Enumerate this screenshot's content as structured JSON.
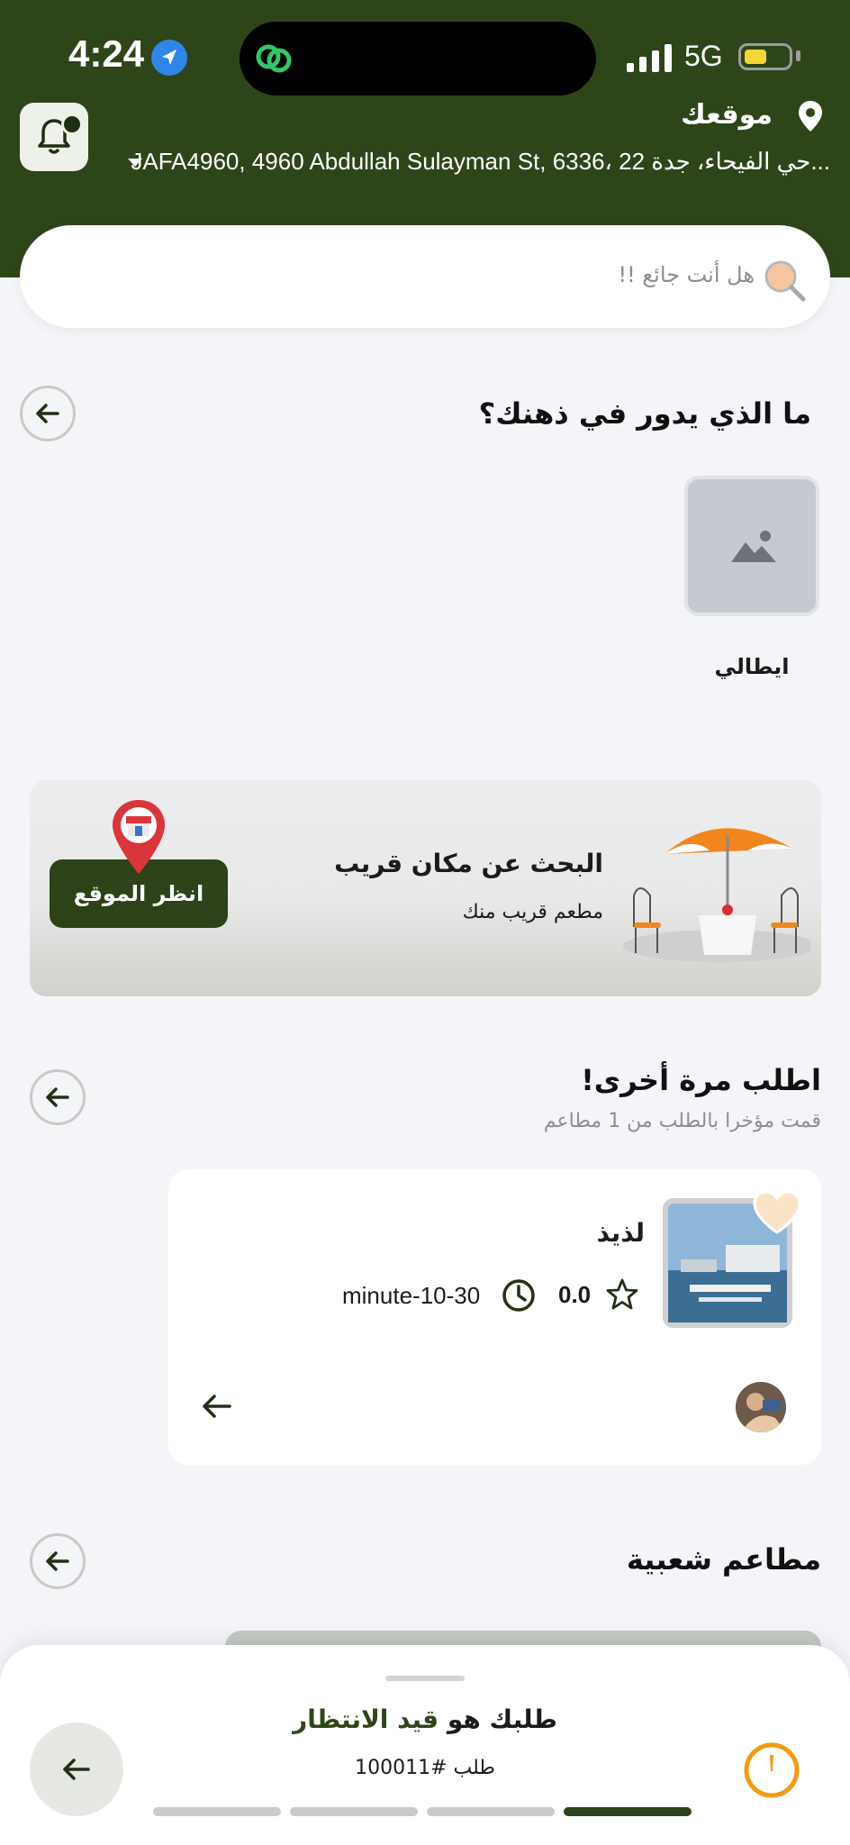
{
  "status_bar": {
    "time": "4:24",
    "network": "5G"
  },
  "header": {
    "location_title": "موقعك",
    "address": "JAFA4960, 4960 Abdullah Sulayman St, 6336، حي الفيحاء، جدة 22..."
  },
  "search": {
    "placeholder": "هل أنت جائع !!"
  },
  "categories_section": {
    "title": "ما الذي يدور في ذهنك؟",
    "items": [
      {
        "label": "ايطالي"
      }
    ]
  },
  "nearby_banner": {
    "title": "البحث عن مكان قريب",
    "subtitle": "مطعم قريب منك",
    "button_label": "انظر الموقع"
  },
  "reorder_section": {
    "title": "اطلب مرة أخرى!",
    "subtitle": "قمت مؤخرا بالطلب من 1 مطاعم",
    "restaurant": {
      "name": "لذيذ",
      "rating": "0.0",
      "delivery_time": "minute-10-30"
    }
  },
  "popular_section": {
    "title": "مطاعم شعبية"
  },
  "order_sheet": {
    "status_prefix": "طلبك هو ",
    "status_highlight": "قيد الانتظار",
    "order_number": "طلب #100011",
    "progress_steps_total": 4,
    "progress_steps_done": 1
  },
  "colors": {
    "header_bg": "#2e4519",
    "accent": "#2d4219",
    "timer": "#f29a12",
    "background": "#f4f5f8"
  }
}
